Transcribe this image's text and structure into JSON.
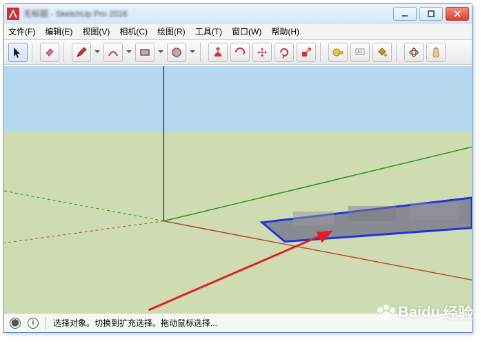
{
  "title": "无标题 - SketchUp Pro 2016",
  "menu": {
    "file": "文件(F)",
    "edit": "编辑(E)",
    "view": "视图(V)",
    "camera": "相机(C)",
    "draw": "绘图(R)",
    "tools": "工具(T)",
    "window": "窗口(W)",
    "help": "帮助(H)"
  },
  "status": {
    "text": "选择对象。切换到扩充选择。拖动鼠标选择..."
  },
  "watermark": {
    "brand": "Bai",
    "brand2": "du",
    "label": "经验"
  },
  "tools_labels": {
    "select": "选择",
    "eraser": "橡皮",
    "pencil": "铅笔",
    "arc": "圆弧",
    "rect": "矩形",
    "circle": "圆",
    "pushpull": "推拉",
    "offset": "偏移",
    "move": "移动",
    "rotate": "旋转",
    "scale": "缩放",
    "tape": "卷尺",
    "text": "文字",
    "paint": "颜料桶",
    "orbit": "环绕",
    "pan": "平移"
  }
}
